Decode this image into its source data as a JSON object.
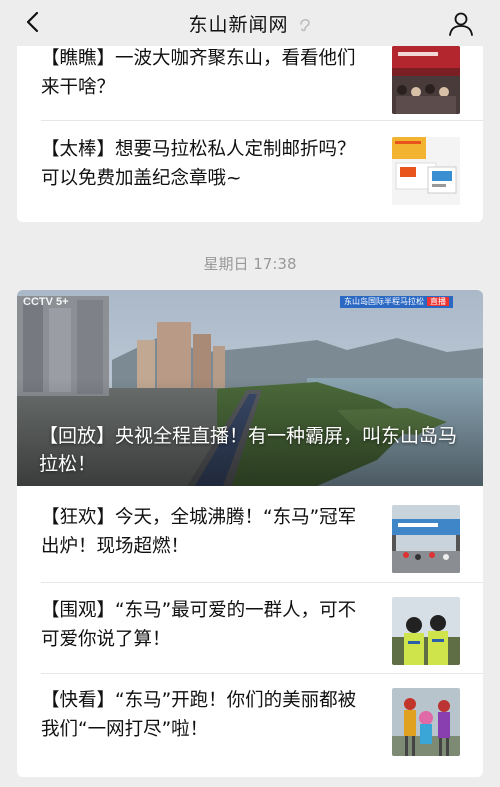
{
  "nav": {
    "title": "东山新闻网"
  },
  "top_card": {
    "items": [
      {
        "text": "【瞧瞧】一波大咖齐聚东山，看看他们来干啥？",
        "thumb": "conference-photo"
      },
      {
        "text": "【太棒】想要马拉松私人定制邮折吗？可以免费加盖纪念章哦~",
        "thumb": "postal-folder-photo"
      }
    ]
  },
  "timestamp": "星期日 17:38",
  "bottom_card": {
    "hero": {
      "caption": "【回放】央视全程直播！有一种霸屏，叫东山岛马拉松！",
      "logo": "CCTV 5+",
      "banner": "东山岛国际半程马拉松",
      "live": "直播"
    },
    "items": [
      {
        "text": "【狂欢】今天，全城沸腾！“东马”冠军出炉！现场超燃！",
        "thumb": "finish-line-photo"
      },
      {
        "text": "【围观】“东马”最可爱的一群人，可不可爱你说了算！",
        "thumb": "police-officers-photo"
      },
      {
        "text": "【快看】“东马”开跑！你们的美丽都被我们“一网打尽”啦！",
        "thumb": "costume-performers-photo"
      }
    ]
  },
  "colors": {
    "background": "#ededed",
    "card": "#ffffff",
    "timestamp": "#999999"
  }
}
